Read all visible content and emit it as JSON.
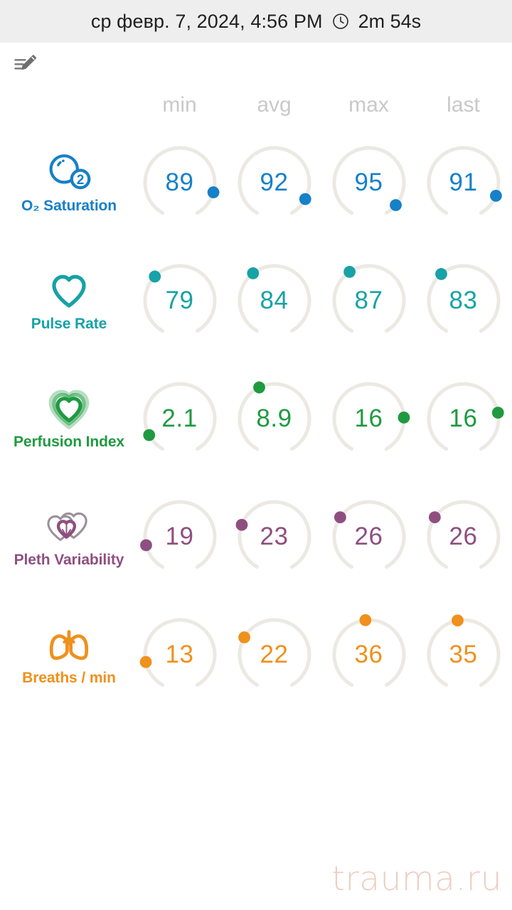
{
  "header": {
    "datetime": "ср февр. 7, 2024, 4:56 PM",
    "clock_icon": "clock-icon",
    "duration": "2m 54s"
  },
  "toolbar": {
    "edit_note_icon": "edit-note-icon"
  },
  "table": {
    "columns": [
      "min",
      "avg",
      "max",
      "last"
    ],
    "track_color": "#ece9e3",
    "rows": [
      {
        "name": "O₂ Saturation",
        "icon": "oxygen-saturation-icon",
        "color": "#1680c8",
        "values": [
          "89",
          "92",
          "95",
          "91"
        ],
        "dot_angles": [
          106,
          118,
          130,
          112
        ]
      },
      {
        "name": "Pulse Rate",
        "icon": "heart-outline-icon",
        "color": "#17a2a6",
        "values": [
          "79",
          "84",
          "87",
          "83"
        ],
        "dot_angles": [
          -46,
          -38,
          -34,
          -40
        ]
      },
      {
        "name": "Perfusion Index",
        "icon": "nested-hearts-icon",
        "color": "#1f9a40",
        "values": [
          "2.1",
          "8.9",
          "16",
          "16"
        ],
        "dot_angles": [
          -118,
          -26,
          88,
          80
        ]
      },
      {
        "name": "Pleth Variability",
        "icon": "overlapping-hearts-icon",
        "color": "#8e4f80",
        "values": [
          "19",
          "23",
          "26",
          "26"
        ],
        "dot_angles": [
          -104,
          -70,
          -56,
          -56
        ]
      },
      {
        "name": "Breaths / min",
        "icon": "lungs-icon",
        "color": "#f0901d",
        "values": [
          "13",
          "22",
          "36",
          "35"
        ],
        "dot_angles": [
          -102,
          -60,
          -6,
          -10
        ]
      }
    ]
  },
  "watermark": {
    "text": "trauma.ru"
  }
}
